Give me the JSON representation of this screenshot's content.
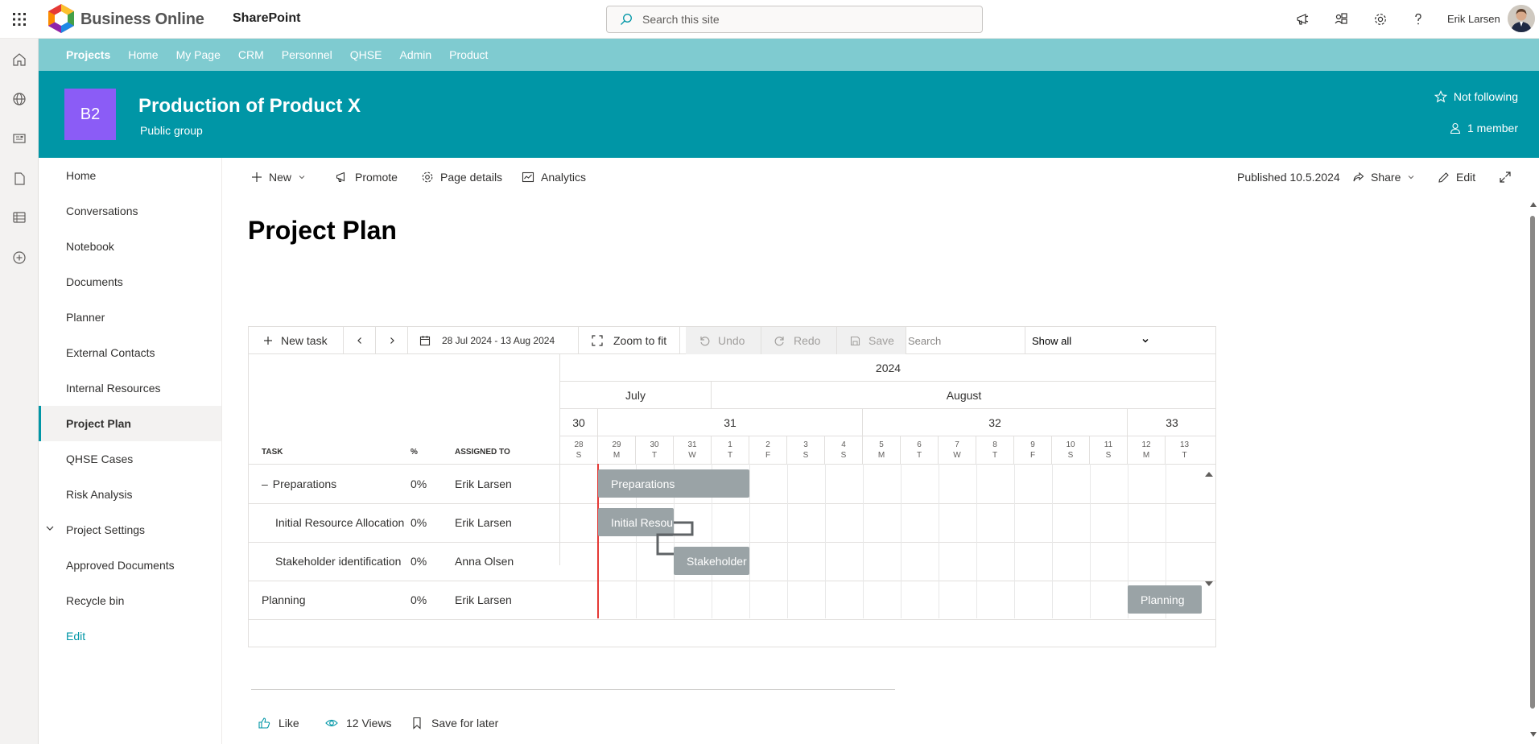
{
  "suitebar": {
    "brand": "Business Online",
    "app": "SharePoint",
    "search_placeholder": "Search this site",
    "user_name": "Erik Larsen"
  },
  "hubnav": {
    "items": [
      "Projects",
      "Home",
      "My Page",
      "CRM",
      "Personnel",
      "QHSE",
      "Admin",
      "Product"
    ]
  },
  "site": {
    "logo_initials": "B2",
    "title": "Production of Product X",
    "subtitle": "Public group",
    "follow_label": "Not following",
    "members_label": "1 member",
    "accent_color": "#0096a6",
    "hub_color": "#7fcbd0",
    "logo_color": "#8b5cf6"
  },
  "leftnav": {
    "items": [
      "Home",
      "Conversations",
      "Notebook",
      "Documents",
      "Planner",
      "External Contacts",
      "Internal Resources",
      "Project Plan",
      "QHSE Cases",
      "Risk Analysis",
      "Project Settings",
      "Approved Documents",
      "Recycle bin",
      "Edit"
    ],
    "selected": "Project Plan"
  },
  "commandbar": {
    "new": "New",
    "promote": "Promote",
    "page_details": "Page details",
    "analytics": "Analytics",
    "published": "Published 10.5.2024",
    "share": "Share",
    "edit": "Edit"
  },
  "page": {
    "title": "Project Plan"
  },
  "gantt": {
    "toolbar": {
      "new_task": "New task",
      "date_range": "28 Jul 2024 - 13 Aug 2024",
      "zoom": "Zoom to fit",
      "undo": "Undo",
      "redo": "Redo",
      "save": "Save",
      "search_placeholder": "Search",
      "filter": "Show all"
    },
    "columns": {
      "task": "TASK",
      "percent": "%",
      "assigned": "ASSIGNED TO"
    },
    "year": "2024",
    "months": [
      "July",
      "August"
    ],
    "weeks": [
      "30",
      "31",
      "32",
      "33"
    ],
    "days": [
      {
        "d": "28",
        "w": "S"
      },
      {
        "d": "29",
        "w": "M"
      },
      {
        "d": "30",
        "w": "T"
      },
      {
        "d": "31",
        "w": "W"
      },
      {
        "d": "1",
        "w": "T"
      },
      {
        "d": "2",
        "w": "F"
      },
      {
        "d": "3",
        "w": "S"
      },
      {
        "d": "4",
        "w": "S"
      },
      {
        "d": "5",
        "w": "M"
      },
      {
        "d": "6",
        "w": "T"
      },
      {
        "d": "7",
        "w": "W"
      },
      {
        "d": "8",
        "w": "T"
      },
      {
        "d": "9",
        "w": "F"
      },
      {
        "d": "10",
        "w": "S"
      },
      {
        "d": "11",
        "w": "S"
      },
      {
        "d": "12",
        "w": "M"
      },
      {
        "d": "13",
        "w": "T"
      }
    ],
    "today_date": "29 Jul 2024",
    "tasks": [
      {
        "name": "Preparations",
        "collapse": "–",
        "percent": "0%",
        "assigned": "Erik Larsen",
        "bar_label": "Preparations",
        "start": "29 Jul 2024",
        "end": "1 Aug 2024"
      },
      {
        "name": "Initial Resource Allocation",
        "percent": "0%",
        "assigned": "Erik Larsen",
        "bar_label": "Initial Resou",
        "start": "29 Jul 2024",
        "end": "30 Jul 2024"
      },
      {
        "name": "Stakeholder identification",
        "percent": "0%",
        "assigned": "Anna Olsen",
        "bar_label": "Stakeholder",
        "start": "31 Jul 2024",
        "end": "1 Aug 2024"
      },
      {
        "name": "Planning",
        "percent": "0%",
        "assigned": "Erik Larsen",
        "bar_label": "Planning",
        "start": "12 Aug 2024",
        "end": "13 Aug 2024"
      }
    ]
  },
  "footer": {
    "like": "Like",
    "views": "12 Views",
    "save_later": "Save for later"
  }
}
